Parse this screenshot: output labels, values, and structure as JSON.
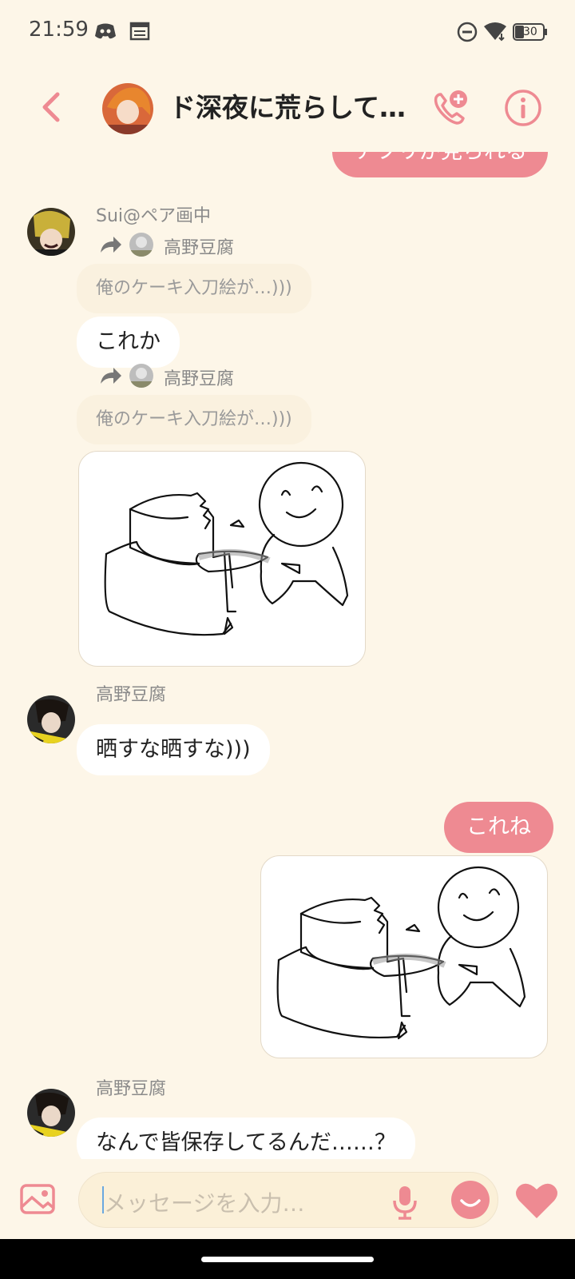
{
  "status_bar": {
    "time": "21:59",
    "battery": "30",
    "icons": [
      "discord-icon",
      "calendar-icon",
      "dnd-icon",
      "wifi-icon",
      "battery-icon"
    ]
  },
  "header": {
    "title": "ド深夜に荒らして…",
    "icons": [
      "back-icon",
      "group-avatar",
      "add-call-icon",
      "info-icon"
    ]
  },
  "messages": {
    "partial_top": "アプリが見られる",
    "m1": {
      "sender": "Sui@ペア画中",
      "fwd1_name": "高野豆腐",
      "fwd1_quote": "俺のケーキ入刀絵が…)))",
      "text": "これか",
      "fwd2_name": "高野豆腐",
      "fwd2_quote": "俺のケーキ入刀絵が…)))"
    },
    "m2": {
      "sender": "高野豆腐",
      "text": "晒すな晒すな)))"
    },
    "m3": {
      "text": "これね"
    },
    "m4": {
      "sender": "高野豆腐",
      "text": "なんで皆保存してるんだ……？"
    }
  },
  "input_bar": {
    "placeholder": "メッセージを入力…",
    "icons": [
      "image-icon",
      "mic-icon",
      "emoji-icon",
      "heart-icon"
    ]
  },
  "colors": {
    "accent": "#ee8a92",
    "background": "#fdf6e8"
  }
}
